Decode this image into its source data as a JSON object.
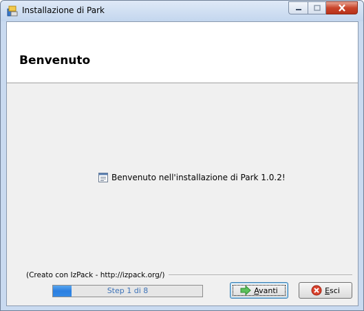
{
  "window": {
    "title": "Installazione di  Park",
    "icons": {
      "app": "installer-icon",
      "minimize": "minimize-icon",
      "maximize": "maximize-icon",
      "close": "close-icon"
    }
  },
  "header": {
    "title": "Benvenuto"
  },
  "main": {
    "welcome_text": "Benvenuto nell'installazione di Park 1.0.2!",
    "welcome_icon": "document-icon"
  },
  "footer": {
    "credit": "(Creato con IzPack - http://izpack.org/)",
    "progress": {
      "label": "Step 1 di 8",
      "current": 1,
      "total": 8,
      "fill_fraction": 0.125
    },
    "next_button": {
      "mnemonic": "A",
      "rest": "vanti",
      "icon": "green-arrow-right-icon"
    },
    "quit_button": {
      "mnemonic": "E",
      "rest": "sci",
      "icon": "red-x-icon"
    }
  },
  "colors": {
    "titlebar": "#c3d6ee",
    "client": "#f0f0f0",
    "close_button": "#c9452b",
    "progress": "#2c7fe0"
  }
}
